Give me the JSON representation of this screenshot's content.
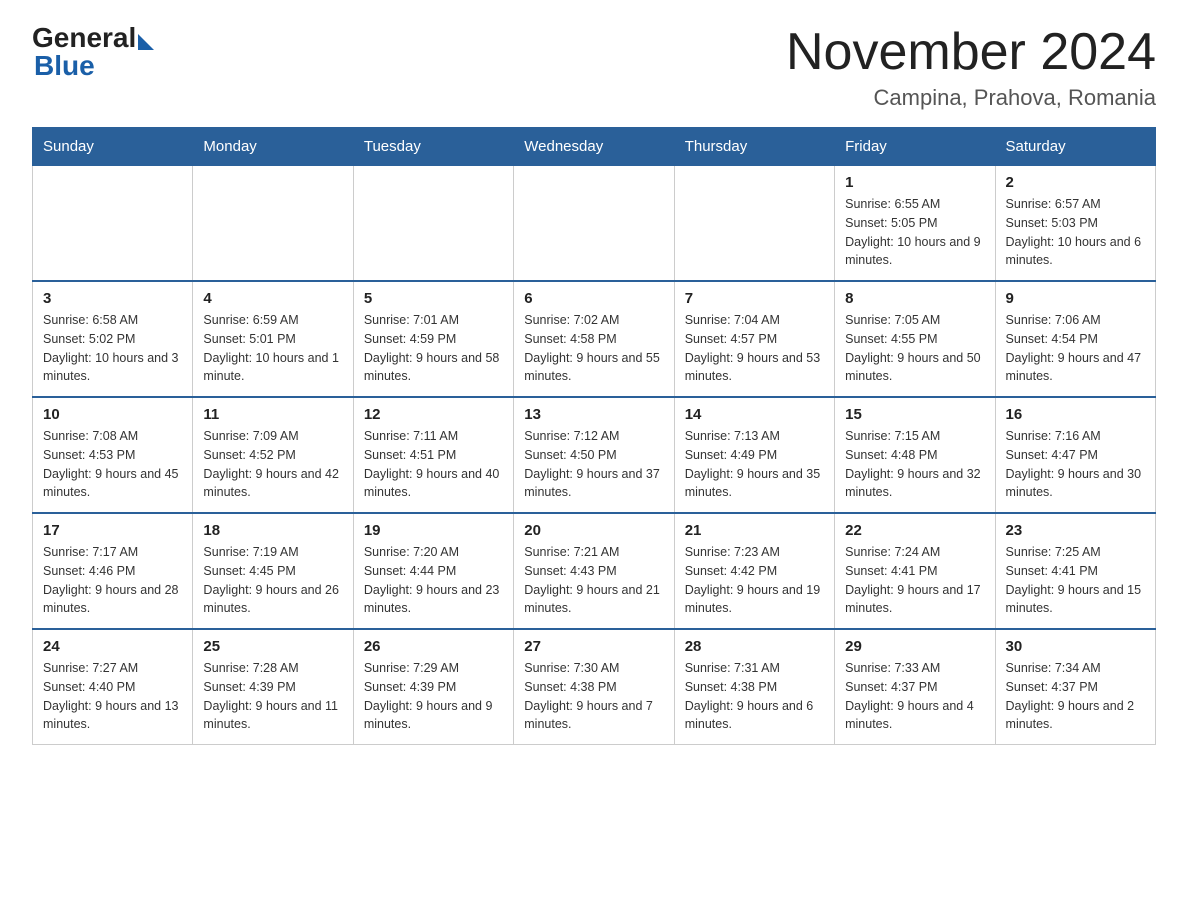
{
  "header": {
    "logo_general": "General",
    "logo_blue": "Blue",
    "month_title": "November 2024",
    "location": "Campina, Prahova, Romania"
  },
  "weekdays": [
    "Sunday",
    "Monday",
    "Tuesday",
    "Wednesday",
    "Thursday",
    "Friday",
    "Saturday"
  ],
  "weeks": [
    [
      {
        "day": "",
        "info": ""
      },
      {
        "day": "",
        "info": ""
      },
      {
        "day": "",
        "info": ""
      },
      {
        "day": "",
        "info": ""
      },
      {
        "day": "",
        "info": ""
      },
      {
        "day": "1",
        "info": "Sunrise: 6:55 AM\nSunset: 5:05 PM\nDaylight: 10 hours and 9 minutes."
      },
      {
        "day": "2",
        "info": "Sunrise: 6:57 AM\nSunset: 5:03 PM\nDaylight: 10 hours and 6 minutes."
      }
    ],
    [
      {
        "day": "3",
        "info": "Sunrise: 6:58 AM\nSunset: 5:02 PM\nDaylight: 10 hours and 3 minutes."
      },
      {
        "day": "4",
        "info": "Sunrise: 6:59 AM\nSunset: 5:01 PM\nDaylight: 10 hours and 1 minute."
      },
      {
        "day": "5",
        "info": "Sunrise: 7:01 AM\nSunset: 4:59 PM\nDaylight: 9 hours and 58 minutes."
      },
      {
        "day": "6",
        "info": "Sunrise: 7:02 AM\nSunset: 4:58 PM\nDaylight: 9 hours and 55 minutes."
      },
      {
        "day": "7",
        "info": "Sunrise: 7:04 AM\nSunset: 4:57 PM\nDaylight: 9 hours and 53 minutes."
      },
      {
        "day": "8",
        "info": "Sunrise: 7:05 AM\nSunset: 4:55 PM\nDaylight: 9 hours and 50 minutes."
      },
      {
        "day": "9",
        "info": "Sunrise: 7:06 AM\nSunset: 4:54 PM\nDaylight: 9 hours and 47 minutes."
      }
    ],
    [
      {
        "day": "10",
        "info": "Sunrise: 7:08 AM\nSunset: 4:53 PM\nDaylight: 9 hours and 45 minutes."
      },
      {
        "day": "11",
        "info": "Sunrise: 7:09 AM\nSunset: 4:52 PM\nDaylight: 9 hours and 42 minutes."
      },
      {
        "day": "12",
        "info": "Sunrise: 7:11 AM\nSunset: 4:51 PM\nDaylight: 9 hours and 40 minutes."
      },
      {
        "day": "13",
        "info": "Sunrise: 7:12 AM\nSunset: 4:50 PM\nDaylight: 9 hours and 37 minutes."
      },
      {
        "day": "14",
        "info": "Sunrise: 7:13 AM\nSunset: 4:49 PM\nDaylight: 9 hours and 35 minutes."
      },
      {
        "day": "15",
        "info": "Sunrise: 7:15 AM\nSunset: 4:48 PM\nDaylight: 9 hours and 32 minutes."
      },
      {
        "day": "16",
        "info": "Sunrise: 7:16 AM\nSunset: 4:47 PM\nDaylight: 9 hours and 30 minutes."
      }
    ],
    [
      {
        "day": "17",
        "info": "Sunrise: 7:17 AM\nSunset: 4:46 PM\nDaylight: 9 hours and 28 minutes."
      },
      {
        "day": "18",
        "info": "Sunrise: 7:19 AM\nSunset: 4:45 PM\nDaylight: 9 hours and 26 minutes."
      },
      {
        "day": "19",
        "info": "Sunrise: 7:20 AM\nSunset: 4:44 PM\nDaylight: 9 hours and 23 minutes."
      },
      {
        "day": "20",
        "info": "Sunrise: 7:21 AM\nSunset: 4:43 PM\nDaylight: 9 hours and 21 minutes."
      },
      {
        "day": "21",
        "info": "Sunrise: 7:23 AM\nSunset: 4:42 PM\nDaylight: 9 hours and 19 minutes."
      },
      {
        "day": "22",
        "info": "Sunrise: 7:24 AM\nSunset: 4:41 PM\nDaylight: 9 hours and 17 minutes."
      },
      {
        "day": "23",
        "info": "Sunrise: 7:25 AM\nSunset: 4:41 PM\nDaylight: 9 hours and 15 minutes."
      }
    ],
    [
      {
        "day": "24",
        "info": "Sunrise: 7:27 AM\nSunset: 4:40 PM\nDaylight: 9 hours and 13 minutes."
      },
      {
        "day": "25",
        "info": "Sunrise: 7:28 AM\nSunset: 4:39 PM\nDaylight: 9 hours and 11 minutes."
      },
      {
        "day": "26",
        "info": "Sunrise: 7:29 AM\nSunset: 4:39 PM\nDaylight: 9 hours and 9 minutes."
      },
      {
        "day": "27",
        "info": "Sunrise: 7:30 AM\nSunset: 4:38 PM\nDaylight: 9 hours and 7 minutes."
      },
      {
        "day": "28",
        "info": "Sunrise: 7:31 AM\nSunset: 4:38 PM\nDaylight: 9 hours and 6 minutes."
      },
      {
        "day": "29",
        "info": "Sunrise: 7:33 AM\nSunset: 4:37 PM\nDaylight: 9 hours and 4 minutes."
      },
      {
        "day": "30",
        "info": "Sunrise: 7:34 AM\nSunset: 4:37 PM\nDaylight: 9 hours and 2 minutes."
      }
    ]
  ]
}
